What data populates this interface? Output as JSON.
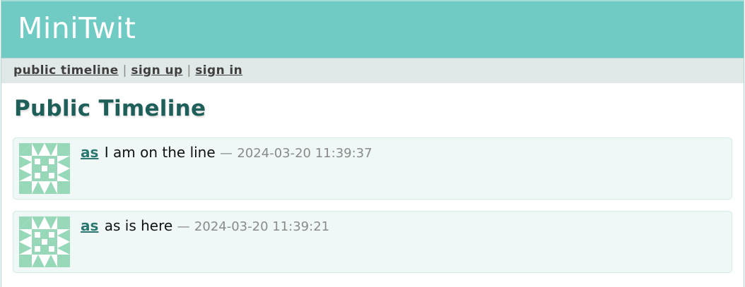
{
  "app": {
    "brand": "MiniTwit"
  },
  "nav": {
    "items": [
      {
        "label": "public timeline"
      },
      {
        "label": "sign up"
      },
      {
        "label": "sign in"
      }
    ],
    "separator": "|"
  },
  "main": {
    "title": "Public Timeline",
    "messages": [
      {
        "username": "as",
        "text": "I am on the line",
        "timestamp_prefix": "—",
        "timestamp": "2024-03-20 11:39:37",
        "avatar_icon": "identicon-avatar-icon"
      },
      {
        "username": "as",
        "text": "as is here",
        "timestamp_prefix": "—",
        "timestamp": "2024-03-20 11:39:21",
        "avatar_icon": "identicon-avatar-icon"
      }
    ]
  },
  "colors": {
    "header_bg": "#6fcbc4",
    "nav_bg": "#e1e9e8",
    "title_color": "#1f5f5a",
    "message_bg": "#eff8f7",
    "avatar_fg": "#97d8b8",
    "username_color": "#2a7771"
  }
}
